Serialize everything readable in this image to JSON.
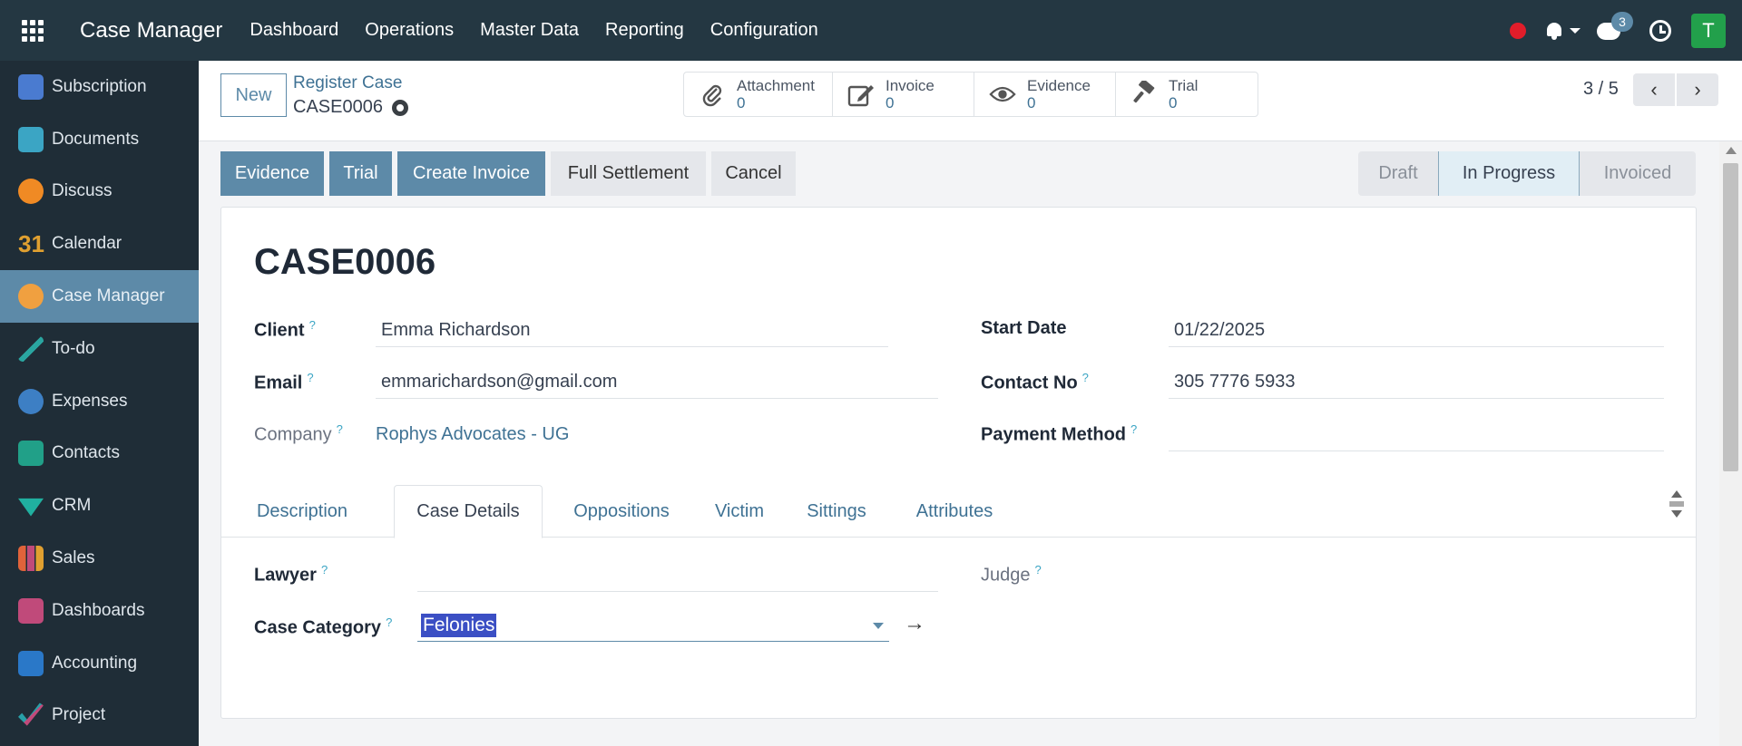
{
  "topnav": {
    "app_title": "Case Manager",
    "menu": [
      "Dashboard",
      "Operations",
      "Master Data",
      "Reporting",
      "Configuration"
    ],
    "chat_badge": "3",
    "avatar_letter": "T"
  },
  "sidebar": {
    "items": [
      {
        "label": "Subscription",
        "color": "#4a7bd0"
      },
      {
        "label": "Documents",
        "color": "#3ba5c4"
      },
      {
        "label": "Discuss",
        "color": "#f08a24"
      },
      {
        "label": "Calendar",
        "color": "#c0475f"
      },
      {
        "label": "Case Manager",
        "color": "#f0a040"
      },
      {
        "label": "To-do",
        "color": "#2aa5a0"
      },
      {
        "label": "Expenses",
        "color": "#3d7fc4"
      },
      {
        "label": "Contacts",
        "color": "#21a088"
      },
      {
        "label": "CRM",
        "color": "#20b0a0"
      },
      {
        "label": "Sales",
        "color": "#e0633a"
      },
      {
        "label": "Dashboards",
        "color": "#c04a7a"
      },
      {
        "label": "Accounting",
        "color": "#2a78c8"
      },
      {
        "label": "Project",
        "color": "#28a0a8"
      }
    ],
    "active_index": 4
  },
  "control": {
    "new_label": "New",
    "breadcrumb_parent": "Register Case",
    "breadcrumb_current": "CASE0006",
    "smart_buttons": [
      {
        "label": "Attachment",
        "count": "0",
        "icon": "paperclip-icon"
      },
      {
        "label": "Invoice",
        "count": "0",
        "icon": "edit-icon"
      },
      {
        "label": "Evidence",
        "count": "0",
        "icon": "eye-icon"
      },
      {
        "label": "Trial",
        "count": "0",
        "icon": "gavel-icon"
      }
    ],
    "pager": "3 / 5"
  },
  "actions": {
    "evidence": "Evidence",
    "trial": "Trial",
    "create_invoice": "Create Invoice",
    "full_settlement": "Full Settlement",
    "cancel": "Cancel"
  },
  "status": {
    "stages": [
      "Draft",
      "In Progress",
      "Invoiced"
    ],
    "current": "In Progress"
  },
  "form": {
    "title": "CASE0006",
    "client_label": "Client",
    "client": "Emma Richardson",
    "email_label": "Email",
    "email": "emmarichardson@gmail.com",
    "company_label": "Company",
    "company": "Rophys Advocates - UG",
    "start_date_label": "Start Date",
    "start_date": "01/22/2025",
    "contact_label": "Contact No",
    "contact": "305 7776 5933",
    "payment_label": "Payment Method",
    "payment": ""
  },
  "tabs": [
    "Description",
    "Case Details",
    "Oppositions",
    "Victim",
    "Sittings",
    "Attributes"
  ],
  "active_tab": "Case Details",
  "case_details": {
    "lawyer_label": "Lawyer",
    "lawyer": "",
    "judge_label": "Judge",
    "category_label": "Case Category",
    "category": "Felonies"
  }
}
